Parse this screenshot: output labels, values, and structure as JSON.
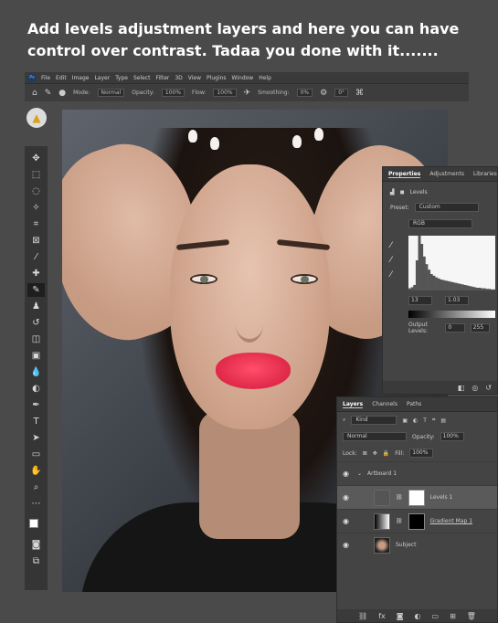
{
  "caption": "Add levels adjustment layers and here you can have control over contrast. Tadaa you done with it.......",
  "menubar": {
    "items": [
      "File",
      "Edit",
      "Image",
      "Layer",
      "Type",
      "Select",
      "Filter",
      "3D",
      "View",
      "Plugins",
      "Window",
      "Help"
    ]
  },
  "options": {
    "mode_label": "Mode:",
    "mode_value": "Normal",
    "opacity_label": "Opacity:",
    "opacity_value": "100%",
    "flow_label": "Flow:",
    "flow_value": "100%",
    "smoothing_label": "Smoothing:",
    "smoothing_value": "0%",
    "angle_value": "0°"
  },
  "properties": {
    "tabs": [
      "Properties",
      "Adjustments",
      "Libraries"
    ],
    "adjustment_name": "Levels",
    "preset_label": "Preset:",
    "preset_value": "Custom",
    "channel_value": "RGB",
    "input_black": "13",
    "input_gamma": "1.03",
    "output_label": "Output Levels:",
    "output_black": "0",
    "output_white": "255",
    "histogram": [
      4,
      6,
      10,
      55,
      100,
      85,
      62,
      48,
      38,
      30,
      27,
      24,
      22,
      20,
      19,
      18,
      17,
      16,
      15,
      14,
      13,
      12,
      11,
      10,
      9,
      8,
      7,
      6,
      5,
      5,
      4,
      4,
      3,
      3,
      2,
      2
    ]
  },
  "layers": {
    "tabs": [
      "Layers",
      "Channels",
      "Paths"
    ],
    "filter_kind": "Kind",
    "blend_mode": "Normal",
    "opacity_label": "Opacity:",
    "opacity_value": "100%",
    "lock_label": "Lock:",
    "fill_label": "Fill:",
    "fill_value": "100%",
    "artboard": "Artboard 1",
    "items": [
      {
        "name": "Levels 1",
        "selected": true
      },
      {
        "name": "Gradient Map 1",
        "selected": false
      },
      {
        "name": "Subject",
        "selected": false
      }
    ]
  },
  "colors": {
    "lipstick": "#e02849",
    "panel_bg": "#444444",
    "app_bg": "#4a4a4a"
  }
}
